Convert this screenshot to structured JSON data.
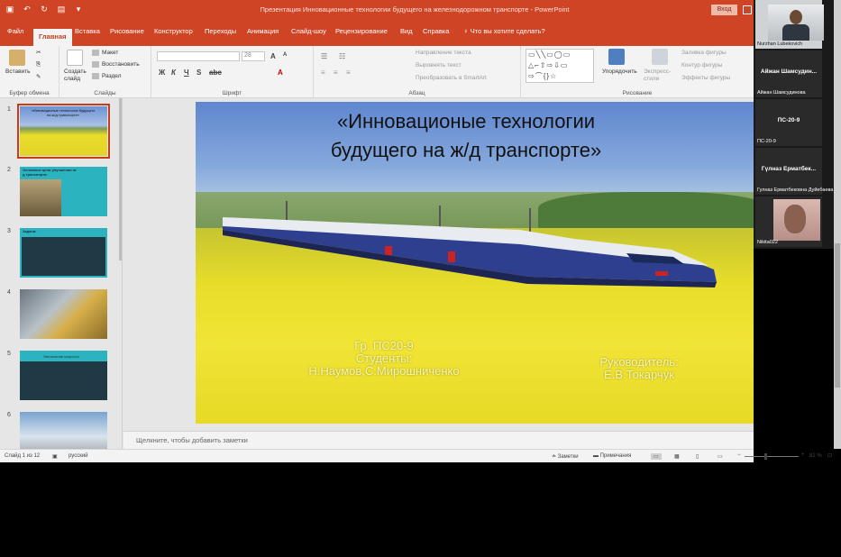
{
  "window": {
    "title": "Презентация Инновационные технологии будущего на железнодорожном транспорте - PowerPoint",
    "signin_label": "Вход"
  },
  "tabs": [
    {
      "label": "Файл"
    },
    {
      "label": "Главная"
    },
    {
      "label": "Вставка"
    },
    {
      "label": "Рисование"
    },
    {
      "label": "Конструктор"
    },
    {
      "label": "Переходы"
    },
    {
      "label": "Анимация"
    },
    {
      "label": "Слайд-шоу"
    },
    {
      "label": "Рецензирование"
    },
    {
      "label": "Вид"
    },
    {
      "label": "Справка"
    }
  ],
  "tell_me": "Что вы хотите сделать?",
  "ribbon": {
    "clipboard": {
      "paste": "Вставить",
      "group": "Буфер обмена"
    },
    "slides": {
      "new_slide": "Создать слайд",
      "layout": "Макет",
      "reset": "Восстановить",
      "section": "Раздел",
      "group": "Слайды"
    },
    "font": {
      "size": "28",
      "group": "Шрифт"
    },
    "paragraph": {
      "text_direction": "Направление текста",
      "align_text": "Выровнять текст",
      "smartart": "Преобразовать в SmartArt",
      "group": "Абзац"
    },
    "drawing": {
      "arrange": "Упорядочить",
      "quick_styles": "Экспресс-стили",
      "fill": "Заливка фигуры",
      "outline": "Контур фигуры",
      "effects": "Эффекты фигуры",
      "group": "Рисование"
    }
  },
  "thumbnails": [
    {
      "num": "1",
      "text": "«Инновационые технологии будущего на ж/д транспорте»"
    },
    {
      "num": "2",
      "text": "Основные цели улучшения ж/д транспорта:"
    },
    {
      "num": "3",
      "text": "Задачи:"
    },
    {
      "num": "4",
      "text": ""
    },
    {
      "num": "5",
      "text": "Увеличение скорости"
    },
    {
      "num": "6",
      "text": ""
    }
  ],
  "slide": {
    "title_line1": "«Инновационые технологии",
    "title_line2": "будущего на ж/д транспорте»",
    "group_line": "Гр. ПС20-9",
    "students_label": "Студенты:",
    "students": "Н.Наумов,С.Мирошниченко",
    "supervisor_label": "Руководитель:",
    "supervisor": "Е.В.Токарчук"
  },
  "notes_placeholder": "Щелкните, чтобы добавить заметки",
  "status": {
    "slide_counter": "Слайд 1 из 12",
    "language": "русский",
    "notes_btn": "Заметки",
    "comments_btn": "Примечания",
    "zoom": "82 %"
  },
  "participants": [
    {
      "name": "Nurzhan Lubekovich",
      "video": true
    },
    {
      "center": "Айжан Шамсудин...",
      "name": "Айжан Шамсудинова",
      "video": false
    },
    {
      "center": "ПС-20-9",
      "name": "ПС-20-9",
      "video": false
    },
    {
      "center": "Гүлназ Ерматбек...",
      "name": "Гулназ Ерматбековна Дуйебаева",
      "video": false
    },
    {
      "name": "Nikita022",
      "video": true
    }
  ],
  "colors": {
    "accent": "#d04426",
    "ribbon_bg": "#f3f3f3",
    "thumb_teal": "#2bb3c0"
  }
}
